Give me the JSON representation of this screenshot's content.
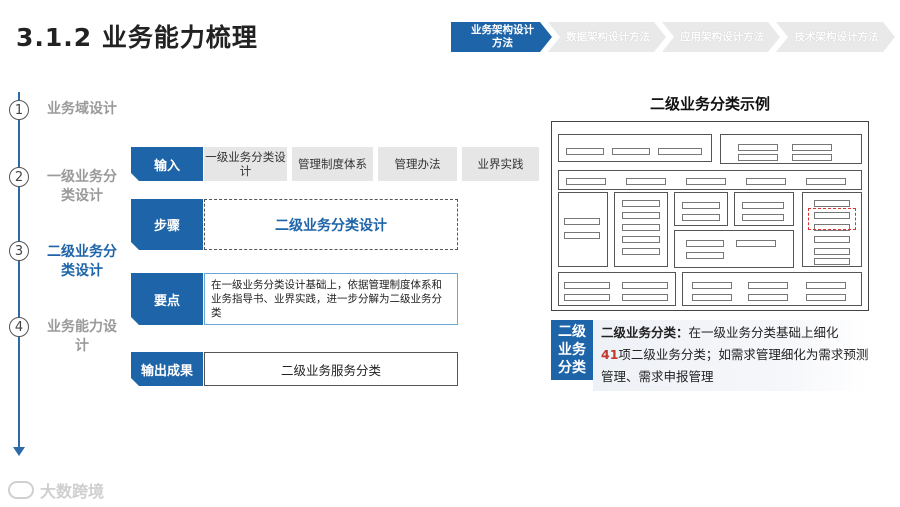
{
  "title": "3.1.2 业务能力梳理",
  "nav": [
    {
      "label": "业务架构设计方法",
      "active": true
    },
    {
      "label": "数据架构设计方法",
      "active": false
    },
    {
      "label": "应用架构设计方法",
      "active": false
    },
    {
      "label": "技术架构设计方法",
      "active": false
    }
  ],
  "steps": [
    {
      "num": "1",
      "label": "业务域设计"
    },
    {
      "num": "2",
      "label": "一级业务分类设计"
    },
    {
      "num": "3",
      "label": "二级业务分类设计"
    },
    {
      "num": "4",
      "label": "业务能力设计"
    }
  ],
  "rows": {
    "input": {
      "tab": "输入",
      "cells": [
        "一级业务分类设计",
        "管理制度体系",
        "管理办法",
        "业界实践"
      ]
    },
    "steps": {
      "tab": "步骤",
      "content": "二级业务分类设计"
    },
    "points": {
      "tab": "要点",
      "content": "在一级业务分类设计基础上，依据管理制度体系和业务指导书、业界实践，进一步分解为二级业务分类"
    },
    "output": {
      "tab": "输出成果",
      "content": "二级业务服务分类"
    }
  },
  "example": {
    "title": "二级业务分类示例",
    "badge": "二级业务分类",
    "desc_label": "二级业务分类：",
    "desc_part1": "在一级业务分类基础上细化",
    "desc_count": "41",
    "desc_part2": "项二级业务分类；如需求管理细化为需求预测管理、需求申报管理"
  },
  "watermark": "大数跨境",
  "colors": {
    "primary": "#1e64a8",
    "accent_red": "#c0392b",
    "grey_cell": "#e6e6e6"
  }
}
